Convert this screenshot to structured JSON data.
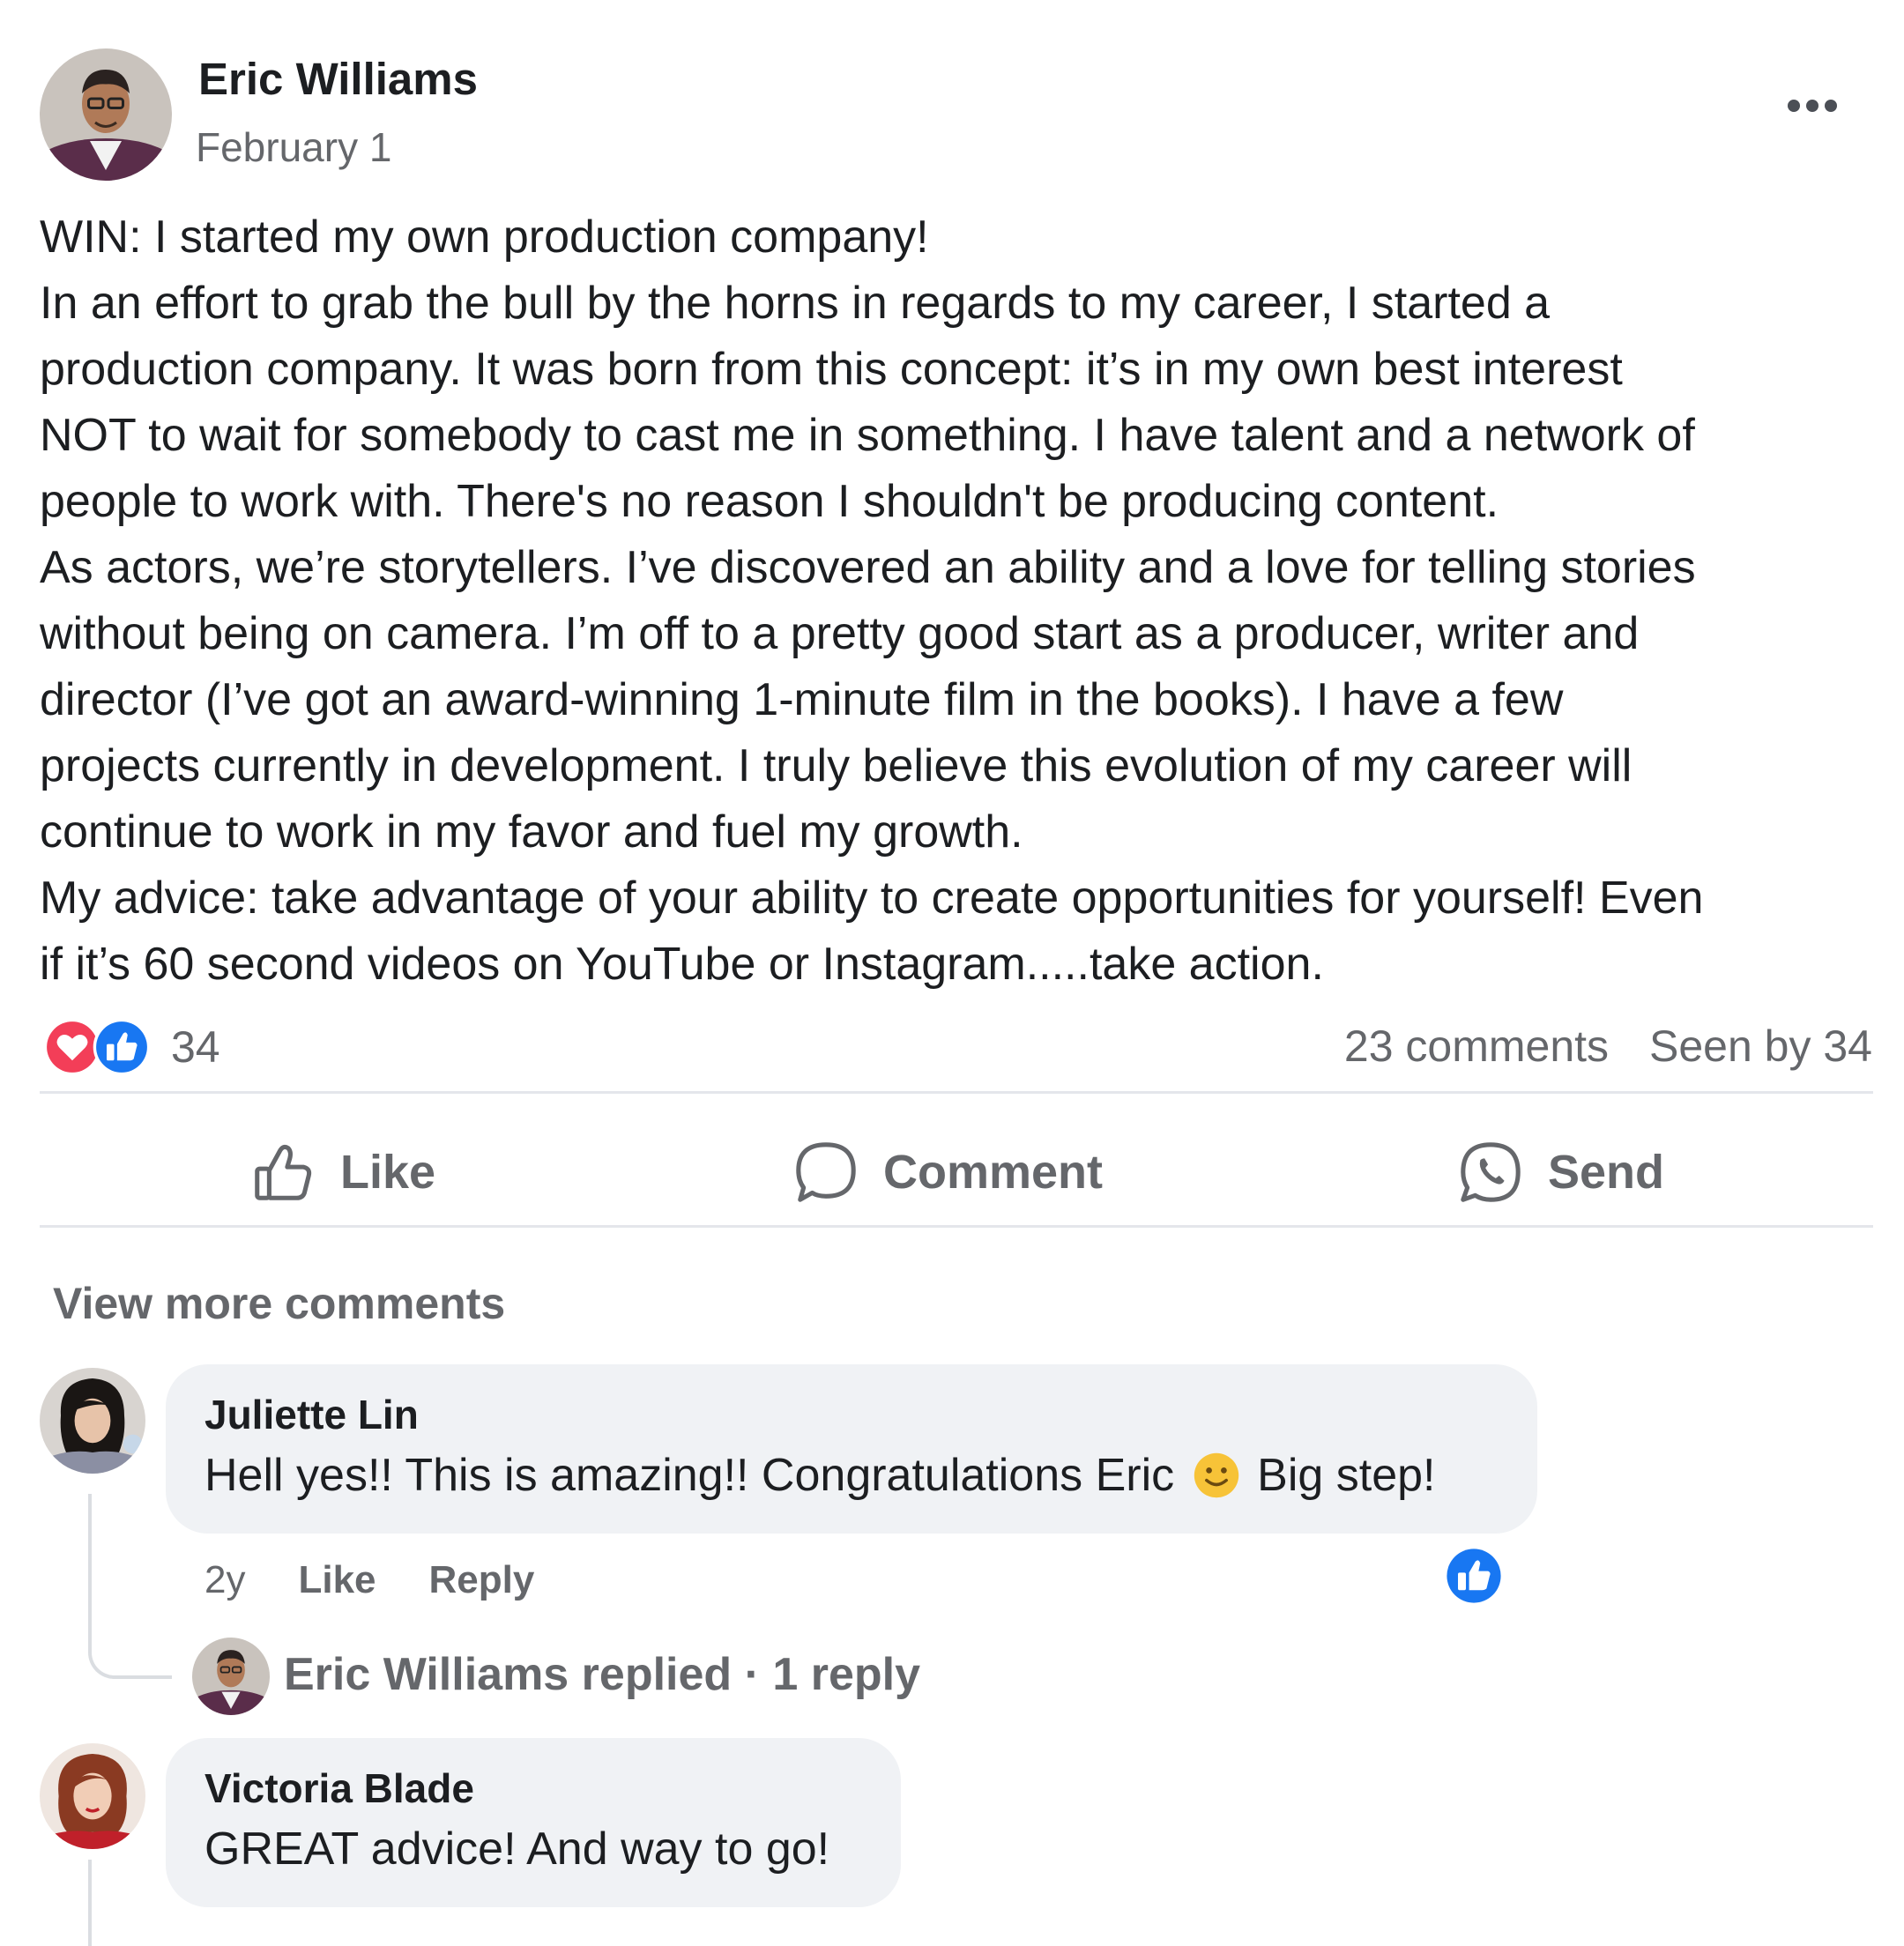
{
  "post": {
    "author": "Eric Williams",
    "date": "February 1",
    "text_lines": [
      "WIN: I started my own production company!",
      "In an effort to grab the bull by the horns in regards to my career, I started a",
      "production company. It was born from this concept: it’s in my own best interest",
      "NOT to wait for somebody to cast me in something. I have talent and a network of",
      "people to work with. There's no reason I shouldn't be producing content.",
      "As actors, we’re storytellers. I’ve discovered an ability and a love for telling stories",
      "without being on camera. I’m off to a pretty good start as a producer, writer and",
      "director (I’ve got an award-winning 1-minute film in the books). I have a few",
      "projects currently in development. I truly believe this evolution of my career will",
      "continue to work in my favor and fuel my growth.",
      "My advice: take advantage of your ability to create opportunities for yourself! Even",
      "if it’s 60 second videos on YouTube or Instagram.....take action."
    ],
    "reaction_count": "34",
    "comments_count": "23 comments",
    "seen_by": "Seen by 34"
  },
  "actions": {
    "like": "Like",
    "comment": "Comment",
    "send": "Send"
  },
  "comments": {
    "view_more": "View more comments",
    "items": [
      {
        "name": "Juliette Lin",
        "text_before": "Hell yes!! This is amazing!! Congratulations Eric",
        "text_after": "Big step!",
        "time": "2y",
        "like": "Like",
        "reply": "Reply",
        "replied": "Eric Williams replied · 1 reply"
      },
      {
        "name": "Victoria Blade",
        "text": "GREAT advice! And way to go!"
      }
    ]
  },
  "colors": {
    "primary_text": "#1c1e21",
    "secondary_text": "#65676b",
    "bubble": "#f0f2f5",
    "like_blue": "#1877f2",
    "love_red": "#f33e58",
    "divider": "#e4e6eb"
  },
  "icons": [
    "more-dots-icon",
    "love-reaction-icon",
    "like-reaction-icon",
    "thumbs-up-icon",
    "comment-bubble-icon",
    "whatsapp-send-icon",
    "smiley-emoji-icon"
  ]
}
